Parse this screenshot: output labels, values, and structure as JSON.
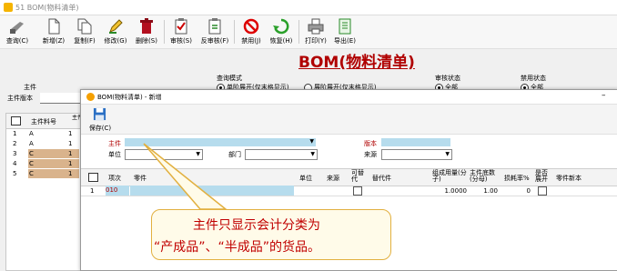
{
  "window": {
    "title": "51 BOM(物料清单)"
  },
  "toolbar": [
    {
      "label": "查询(C)",
      "icon": "query-icon"
    },
    {
      "label": "新增(Z)",
      "icon": "new-document-icon"
    },
    {
      "label": "复制(F)",
      "icon": "copy-icon"
    },
    {
      "label": "修改(G)",
      "icon": "edit-icon"
    },
    {
      "label": "删除(S)",
      "icon": "delete-icon"
    },
    {
      "label": "审核(S)",
      "icon": "approve-icon"
    },
    {
      "label": "反审核(F)",
      "icon": "unapprove-icon"
    },
    {
      "label": "禁用(J)",
      "icon": "disable-icon"
    },
    {
      "label": "恢复(H)",
      "icon": "restore-icon"
    },
    {
      "label": "打印(Y)",
      "icon": "print-icon"
    },
    {
      "label": "导出(E)",
      "icon": "export-icon"
    }
  ],
  "page": {
    "title": "BOM(物料清单)"
  },
  "filters": {
    "main_part_label": "主件",
    "main_part_version_label": "主件版本",
    "mode_label": "查询模式",
    "mode_option1": "单阶展开(仅末格显示)",
    "mode_option2": "展阶展开(仅末格显示)",
    "audit_label": "审核状态",
    "audit_all": "全部",
    "disable_label": "禁用状态",
    "disable_all": "全部"
  },
  "bg_grid": {
    "headers": [
      "主件料号",
      "主件新本"
    ],
    "rows": [
      {
        "num": "1",
        "code": "A",
        "ver": "1"
      },
      {
        "num": "2",
        "code": "A",
        "ver": "1"
      },
      {
        "num": "3",
        "code": "C",
        "ver": "1"
      },
      {
        "num": "4",
        "code": "C",
        "ver": "1"
      },
      {
        "num": "5",
        "code": "C",
        "ver": "1"
      }
    ]
  },
  "dialog": {
    "title": "BOM(物料清单) - 新增",
    "minimize": "–",
    "save_label": "保存(C)",
    "form": {
      "main_part_label": "主件",
      "version_label": "版本",
      "unit_label": "单位",
      "dept_label": "部门",
      "source_label": "来源"
    },
    "grid": {
      "headers": [
        "项次",
        "零件",
        "单位",
        "来源",
        "可替代",
        "替代件",
        "组成用量(分子)",
        "主件底数(分母)",
        "损耗率%",
        "是否展开",
        "零件新本"
      ],
      "rows": [
        {
          "num": "1",
          "item": "010",
          "part": "",
          "unit": "",
          "source": "",
          "sub": "",
          "numerator": "1.0000",
          "denominator": "1.00",
          "loss": "0",
          "version": ""
        }
      ]
    }
  },
  "callout": {
    "line1": "主件只显示会计分类为",
    "line2": "“产成品”、“半成品”的货品。"
  },
  "colors": {
    "accent_red": "#b00000",
    "field_blue": "#b6dced",
    "callout_border": "#e2b040"
  }
}
